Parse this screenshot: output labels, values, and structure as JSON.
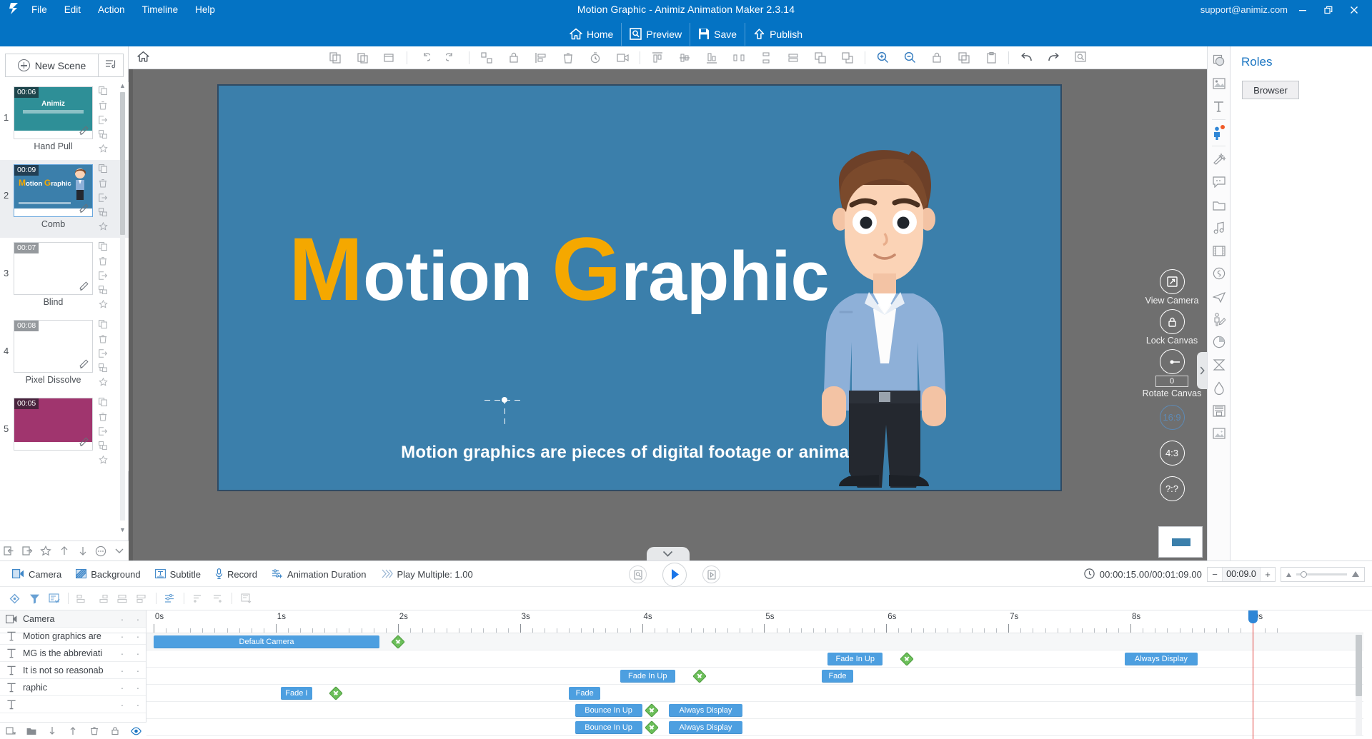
{
  "titlebar": {
    "app_title": "Motion Graphic - Animiz Animation Maker 2.3.14",
    "account": "support@animiz.com",
    "menus": [
      "File",
      "Edit",
      "Action",
      "Timeline",
      "Help"
    ],
    "window_buttons": [
      "minimize-button",
      "restore-button",
      "close-button"
    ],
    "quick_actions": [
      {
        "label": "Home",
        "icon": "home-icon"
      },
      {
        "label": "Preview",
        "icon": "preview-icon"
      },
      {
        "label": "Save",
        "icon": "save-icon"
      },
      {
        "label": "Publish",
        "icon": "publish-icon"
      }
    ]
  },
  "scene_panel": {
    "new_scene_label": "New Scene",
    "sort_icon": "sort-scenes-icon",
    "scenes": [
      {
        "index": "1",
        "duration": "00:06",
        "name": "Hand Pull",
        "selected": false,
        "thumb": "animiz",
        "badge_style": "dark"
      },
      {
        "index": "2",
        "duration": "00:09",
        "name": "Comb",
        "selected": true,
        "thumb": "motion-graphic",
        "badge_style": "dark"
      },
      {
        "index": "3",
        "duration": "00:07",
        "name": "Blind",
        "selected": false,
        "thumb": "blank",
        "badge_style": "grey"
      },
      {
        "index": "4",
        "duration": "00:08",
        "name": "Pixel Dissolve",
        "selected": false,
        "thumb": "blank",
        "badge_style": "grey"
      },
      {
        "index": "5",
        "duration": "00:05",
        "name": "",
        "selected": false,
        "thumb": "magenta",
        "badge_style": "dark"
      }
    ],
    "scene_item_icons": [
      "copy-icon",
      "delete-icon",
      "export-icon",
      "duplicate-icon",
      "favorite-icon"
    ],
    "bottom_tools": [
      "import-scene-icon",
      "export-scene-icon",
      "favorite-icon",
      "move-up-icon",
      "move-down-icon",
      "more-options-icon",
      "collapse-icon"
    ]
  },
  "canvas": {
    "home_icon": "canvas-home-icon",
    "toolbar_icons": [
      "copy-icon",
      "paste-icon",
      "cut-icon",
      "delete-icon",
      "undo-group-icon",
      "redo-group-icon",
      "group-icon",
      "lock-icon",
      "align-left-icon",
      "trash-icon",
      "timer-icon",
      "camera-icon",
      "distribute-h-icon",
      "distribute-v-icon",
      "align-top-icon",
      "align-middle-icon",
      "align-bottom-icon",
      "space-h-icon",
      "bring-front-icon",
      "send-back-icon",
      "zoom-in-icon",
      "zoom-out-icon",
      "lock-canvas-icon",
      "duplicate-icon",
      "clipboard-icon",
      "undo-icon",
      "redo-icon",
      "search-icon"
    ],
    "slide": {
      "title_parts": [
        {
          "text": "M",
          "cap": true
        },
        {
          "text": "otion ",
          "cap": false
        },
        {
          "text": "G",
          "cap": true
        },
        {
          "text": "raphic",
          "cap": false
        }
      ],
      "title_plain": "Motion Graphic",
      "subtitle": "Motion graphics are pieces of digital footage or animation",
      "background_color": "#3b7fab",
      "accent_color": "#f5a800"
    },
    "camera_rail": {
      "view_camera_label": "View Camera",
      "lock_canvas_label": "Lock Canvas",
      "rotate_canvas_label": "Rotate Canvas",
      "rotate_value": "0",
      "ratios": [
        "16:9",
        "4:3",
        "?:?"
      ],
      "active_ratio": "16:9"
    }
  },
  "right_panel": {
    "title": "Roles",
    "browser_label": "Browser",
    "rail_icons": [
      "shape-icon",
      "image-icon",
      "text-icon",
      "role-icon",
      "effect-icon",
      "bubble-icon",
      "folder-icon",
      "music-icon",
      "video-icon",
      "sound-icon",
      "flight-icon",
      "hand-draw-icon",
      "chart-icon",
      "formula-icon",
      "drop-icon",
      "archive-icon",
      "gallery-icon"
    ],
    "active_rail_icon": "role-icon"
  },
  "bottom_bar": {
    "items": [
      {
        "label": "Camera",
        "icon": "camera-icon"
      },
      {
        "label": "Background",
        "icon": "background-icon"
      },
      {
        "label": "Subtitle",
        "icon": "subtitle-icon"
      },
      {
        "label": "Record",
        "icon": "microphone-icon"
      },
      {
        "label": "Animation Duration",
        "icon": "duration-icon"
      },
      {
        "label": "Play Multiple: 1.00",
        "icon": "play-multiple-icon"
      }
    ],
    "transport": [
      "preview-frame-button",
      "play-button",
      "next-frame-button"
    ],
    "timecode": "00:00:15.00/00:01:09.00",
    "clock_icon": "clock-icon",
    "duration_stepper": {
      "minus": "−",
      "value": "00:09.0",
      "plus": "+"
    },
    "zoom_slider": {
      "min_icon": "zoom-small-icon",
      "max_icon": "zoom-large-icon"
    }
  },
  "timeline": {
    "tool_icons": [
      "add-keyframe-icon",
      "filter-icon",
      "track-settings-icon",
      "align-tracks-left-icon",
      "align-tracks-right-icon",
      "align-tracks-center-icon",
      "distribute-tracks-icon",
      "adjust-timing-icon",
      "shift-left-icon",
      "shift-right-icon",
      "export-timeline-icon"
    ],
    "ruler_labels": [
      "0s",
      "1s",
      "2s",
      "3s",
      "4s",
      "5s",
      "6s",
      "7s",
      "8s",
      "9s"
    ],
    "ruler_max_seconds": 9.2,
    "playhead_seconds": 9.0,
    "tracks": [
      {
        "icon": "camera-icon",
        "name": "Camera",
        "is_camera": true,
        "clips": [
          {
            "label": "Default Camera",
            "start": 0.0,
            "end": 1.85
          }
        ],
        "keyframes": [
          2.0
        ]
      },
      {
        "icon": "text-icon",
        "name": "Motion graphics are",
        "is_camera": false,
        "clips": [
          {
            "label": "Fade In Up",
            "start": 5.52,
            "end": 5.97
          },
          {
            "label": "Always Display",
            "start": 7.95,
            "end": 8.55
          }
        ],
        "keyframes": [
          6.17
        ]
      },
      {
        "icon": "text-icon",
        "name": "MG is the abbreviati",
        "is_camera": false,
        "clips": [
          {
            "label": "Fade In Up",
            "start": 3.82,
            "end": 4.27
          },
          {
            "label": "Fade",
            "start": 5.47,
            "end": 5.73
          }
        ],
        "keyframes": [
          4.47
        ]
      },
      {
        "icon": "text-icon",
        "name": "It is not so reasonab",
        "is_camera": false,
        "clips": [
          {
            "label": "Fade I",
            "start": 1.04,
            "end": 1.3
          },
          {
            "label": "Fade",
            "start": 3.4,
            "end": 3.66
          }
        ],
        "keyframes": [
          1.49
        ]
      },
      {
        "icon": "text-icon",
        "name": "raphic",
        "is_camera": false,
        "clips": [
          {
            "label": "Bounce In Up",
            "start": 3.45,
            "end": 4.0
          },
          {
            "label": "Always Display",
            "start": 4.22,
            "end": 4.82
          }
        ],
        "keyframes": [
          4.08
        ]
      },
      {
        "icon": "text-icon",
        "name": "",
        "is_camera": false,
        "clips": [
          {
            "label": "Bounce In Up",
            "start": 3.45,
            "end": 4.0
          },
          {
            "label": "Always Display",
            "start": 4.22,
            "end": 4.82
          }
        ],
        "keyframes": [
          4.08
        ]
      }
    ],
    "bottom_tools": [
      "add-track-icon",
      "folder-icon",
      "move-down-icon",
      "move-up-icon",
      "delete-icon",
      "lock-icon",
      "visibility-icon"
    ]
  }
}
